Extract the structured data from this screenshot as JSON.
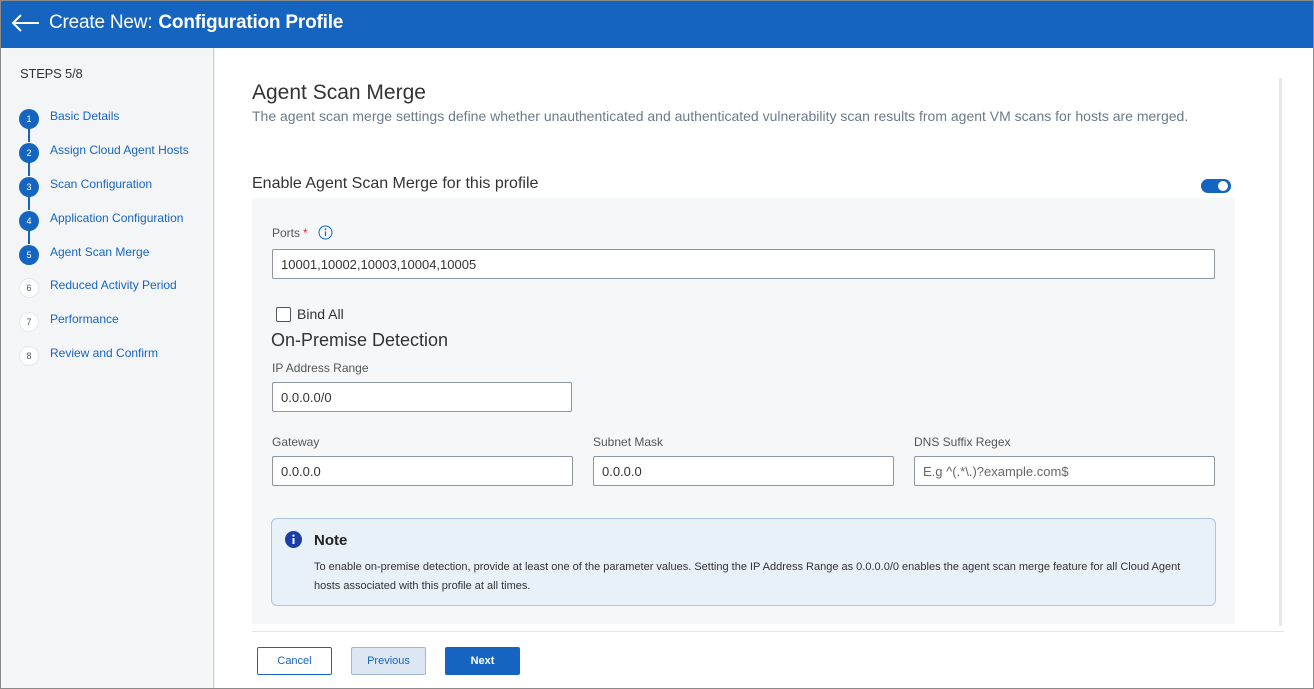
{
  "header": {
    "title_prefix": "Create New:",
    "title_main": "Configuration Profile",
    "back_icon": "arrow-left-icon"
  },
  "sidebar": {
    "steps_label": "STEPS 5/8",
    "steps": [
      {
        "number": "1",
        "label": "Basic Details",
        "state": "done"
      },
      {
        "number": "2",
        "label": "Assign Cloud Agent Hosts",
        "state": "done"
      },
      {
        "number": "3",
        "label": "Scan Configuration",
        "state": "done"
      },
      {
        "number": "4",
        "label": "Application Configuration",
        "state": "done"
      },
      {
        "number": "5",
        "label": "Agent Scan Merge",
        "state": "current"
      },
      {
        "number": "6",
        "label": "Reduced Activity Period",
        "state": "pending"
      },
      {
        "number": "7",
        "label": "Performance",
        "state": "pending"
      },
      {
        "number": "8",
        "label": "Review and Confirm",
        "state": "pending"
      }
    ]
  },
  "main": {
    "title": "Agent Scan Merge",
    "description": "The agent scan merge settings define whether unauthenticated and authenticated vulnerability scan results from agent VM scans for hosts are merged.",
    "enable_label": "Enable Agent Scan Merge for this profile",
    "enable_toggle_on": true,
    "ports": {
      "label": "Ports",
      "required_mark": "*",
      "value": "10001,10002,10003,10004,10005"
    },
    "bind_all": {
      "label": "Bind All",
      "checked": false
    },
    "on_premise_title": "On-Premise Detection",
    "ip_range": {
      "label": "IP Address Range",
      "value": "0.0.0.0/0"
    },
    "gateway": {
      "label": "Gateway",
      "value": "0.0.0.0"
    },
    "subnet_mask": {
      "label": "Subnet Mask",
      "value": "0.0.0.0"
    },
    "dns_suffix": {
      "label": "DNS Suffix Regex",
      "value": "",
      "placeholder": "E.g ^(.*\\.)?example.com$"
    },
    "note": {
      "title": "Note",
      "text": "To enable on-premise detection, provide at least one of the parameter values. Setting the IP Address Range as 0.0.0.0/0 enables the agent scan merge feature for all Cloud Agent hosts associated with this profile at all times."
    }
  },
  "footer": {
    "cancel_label": "Cancel",
    "previous_label": "Previous",
    "next_label": "Next"
  },
  "colors": {
    "brand_blue": "#1565c0",
    "required_red": "#d32f2f"
  }
}
